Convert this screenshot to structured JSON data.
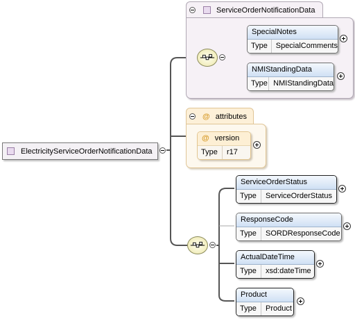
{
  "root": {
    "name": "ElectricityServiceOrderNotificationData"
  },
  "group": {
    "name": "ServiceOrderNotificationData"
  },
  "group_children": [
    {
      "name": "SpecialNotes",
      "type_label": "Type",
      "type_value": "SpecialComments"
    },
    {
      "name": "NMIStandingData",
      "type_label": "Type",
      "type_value": "NMIStandingData"
    }
  ],
  "attributes": {
    "label": "attributes",
    "symbol": "@",
    "items": [
      {
        "name": "version",
        "type_label": "Type",
        "type_value": "r17"
      }
    ]
  },
  "sequence_children": [
    {
      "name": "ServiceOrderStatus",
      "type_label": "Type",
      "type_value": "ServiceOrderStatus"
    },
    {
      "name": "ResponseCode",
      "type_label": "Type",
      "type_value": "SORDResponseCode"
    },
    {
      "name": "ActualDateTime",
      "type_label": "Type",
      "type_value": "xsd:dateTime"
    },
    {
      "name": "Product",
      "type_label": "Type",
      "type_value": "Product"
    }
  ]
}
